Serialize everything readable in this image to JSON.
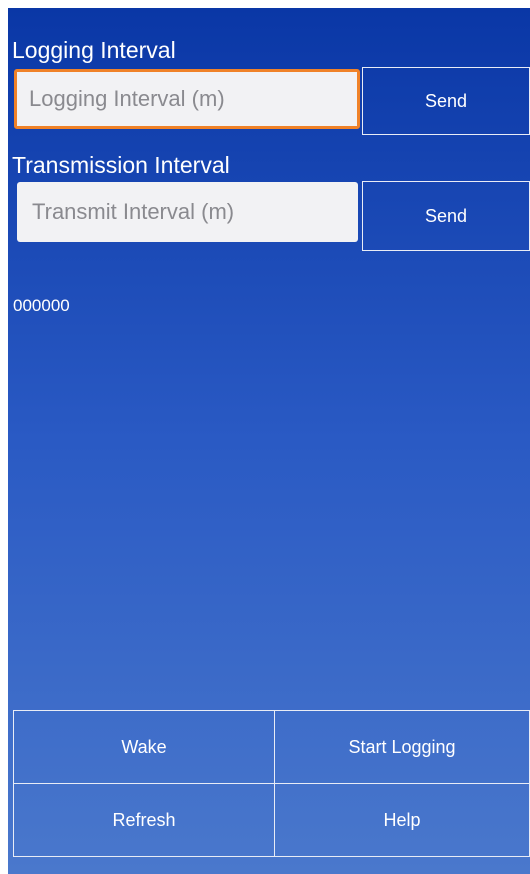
{
  "logging": {
    "label": "Logging Interval",
    "placeholder": "Logging Interval (m)",
    "send_label": "Send"
  },
  "transmission": {
    "label": "Transmission Interval",
    "placeholder": "Transmit Interval (m)",
    "send_label": "Send"
  },
  "status_value": "000000",
  "actions": {
    "wake": "Wake",
    "start_logging": "Start Logging",
    "refresh": "Refresh",
    "help": "Help"
  },
  "colors": {
    "background_top": "#0a37a6",
    "background_bottom": "#4a78cc",
    "focus_border": "#f08228",
    "input_background": "#f2f2f4"
  }
}
